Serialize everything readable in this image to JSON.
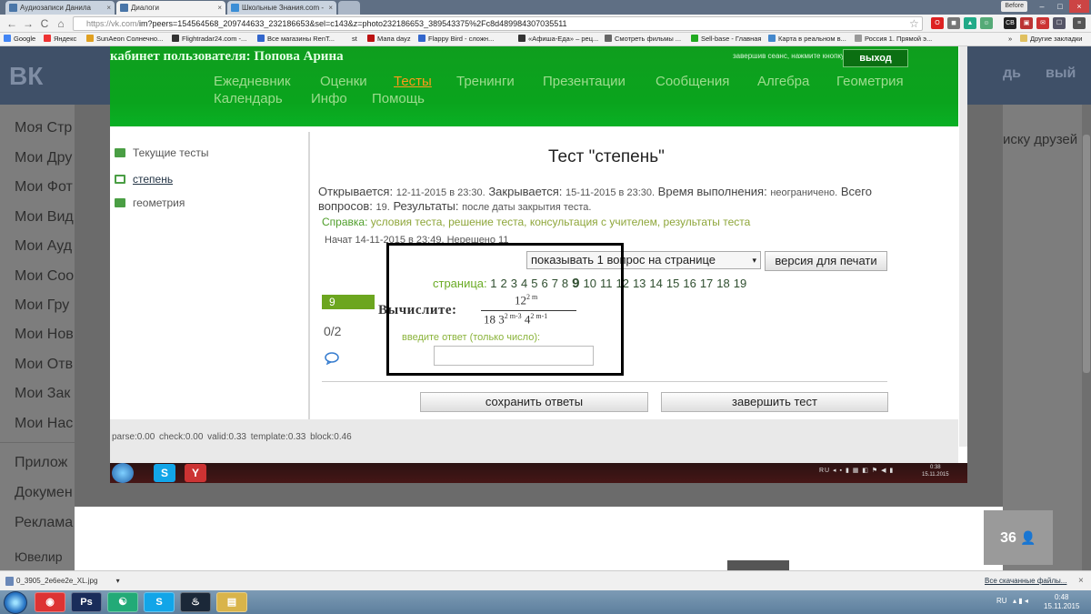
{
  "browser": {
    "tabs": [
      {
        "title": "Аудиозаписи Данила",
        "color": "#4a76a8",
        "close": "×"
      },
      {
        "title": "Диалоги",
        "color": "#4a76a8",
        "close": "×"
      },
      {
        "title": "Школьные Знания.com -",
        "color": "#3b8ed6",
        "close": "×"
      }
    ],
    "user_button": "Before",
    "window_controls": [
      "–",
      "□",
      "×"
    ],
    "nav": {
      "back": "←",
      "forward": "→",
      "reload": "C",
      "home": "⌂"
    },
    "url_host": "https://vk.com/",
    "url_path": "im?peers=154564568_209744633_232186653&sel=c143&z=photo232186653_389543375%2Fc8d489984307035511",
    "star": "☆",
    "extensions": [
      {
        "label": "O",
        "color": "#d22"
      },
      {
        "label": "◼",
        "color": "#777"
      },
      {
        "label": "▲",
        "color": "#2a8"
      },
      {
        "label": "☺",
        "color": "#5a7"
      },
      {
        "label": "CB",
        "color": "#222"
      },
      {
        "label": "▣",
        "color": "#b33"
      },
      {
        "label": "✉",
        "color": "#c33"
      },
      {
        "label": "☐",
        "color": "#556"
      },
      {
        "label": "≡",
        "color": "#555"
      }
    ],
    "bookmarks": [
      {
        "label": "Google",
        "color": "#4285f4"
      },
      {
        "label": "Яндекс",
        "color": "#e33"
      },
      {
        "label": "SunAeon Солнечно...",
        "color": "#e0a020"
      },
      {
        "label": "Flightradar24.com -...",
        "color": "#333"
      },
      {
        "label": "Все магазины RenT...",
        "color": "#36c"
      },
      {
        "label": "st",
        "color": "#888"
      },
      {
        "label": "Мапа dayz",
        "color": "#b11"
      },
      {
        "label": "Flappy Bird - сложн...",
        "color": "#36c"
      },
      {
        "label": "«Афиша-Еда» – рец...",
        "color": "#333"
      },
      {
        "label": "Смотреть фильмы ...",
        "color": "#666"
      },
      {
        "label": "Sell-base - Главная",
        "color": "#2a2"
      },
      {
        "label": "Карта в реальном в...",
        "color": "#48c"
      },
      {
        "label": "Россия 1. Прямой э...",
        "color": "#999"
      }
    ],
    "bookmarks_more": "»",
    "other_bookmarks": "Другие закладки"
  },
  "vk": {
    "logo": "ВК",
    "header_right": [
      "дь",
      "вый"
    ],
    "left_menu": [
      "Моя Стр",
      "Мои Дру",
      "Мои Фот",
      "Мои Вид",
      "Мои Ауд",
      "Мои Соо",
      "Мои Гру",
      "Мои Нов",
      "Мои Отв",
      "Мои Зак",
      "Мои Нас",
      "Прилож",
      "Докумен",
      "Реклама",
      "Ювелир"
    ],
    "right_text": "иску друзей",
    "views_count": "36",
    "views_icon": "👤"
  },
  "photo": {
    "cabinet_title": "кабинет пользователя: Попова Арина",
    "logout_hint": "завершив сеанс, нажмите кнопку",
    "logout_label": "выход",
    "menu_row1": [
      "Ежедневник",
      "Оценки",
      "Тесты",
      "Тренинги",
      "Презентации",
      "Сообщения",
      "Алгебра",
      "Геометрия"
    ],
    "menu_row2": [
      "Календарь",
      "Инфо",
      "Помощь"
    ],
    "active_menu": "Тесты",
    "sidebar": {
      "current_tests": "Текущие тесты",
      "item1": "степень",
      "item2": "геометрия"
    },
    "test_title": "Тест \"степень\"",
    "info": {
      "opens_label": "Открывается:",
      "opens_value": "12-11-2015 в 23:30.",
      "closes_label": "Закрывается:",
      "closes_value": "15-11-2015 в 23:30.",
      "time_label": "Время выполнения:",
      "time_value": "неограничено.",
      "total_label": "Всего",
      "questions_label": "вопросов:",
      "questions_value": "19.",
      "results_label": "Результаты:",
      "results_value": "после даты закрытия теста."
    },
    "reference": {
      "label": "Справка:",
      "links": "условия теста, решение теста, консультация с учителем, результаты теста"
    },
    "started": "Начат 14-11-2015 в 23:49. Нерешено 11",
    "per_page": "показывать 1 вопрос на странице",
    "per_page_arrow": "▾",
    "print_label": "версия для печати",
    "pager_label": "страница:",
    "pages": [
      "1",
      "2",
      "3",
      "4",
      "5",
      "6",
      "7",
      "8",
      "9",
      "10",
      "11",
      "12",
      "13",
      "14",
      "15",
      "16",
      "17",
      "18",
      "19"
    ],
    "current_page": "9",
    "question_number": "9",
    "score": "0/2",
    "calc_label": "Вычислите:",
    "numerator_base": "12",
    "numerator_exp": "2 m",
    "denominator_coef": "18",
    "den_base1": "3",
    "den_exp1": "2 m-3",
    "den_base2": "4",
    "den_exp2": "2 m-1",
    "answer_hint": "введите ответ (только число):",
    "save_label": "сохранить ответы",
    "finish_label": "завершить тест",
    "parse_stats": "parse:0.00 check:0.00 valid:0.33 template:0.33 block:0.46",
    "inner_taskbar": {
      "tray": "RU ◂ ▪ ▮ ▦ ◧ ⚑ ◀ ▮",
      "time": "0:38",
      "date": "15.11.2015"
    }
  },
  "downloads": {
    "file": "0_3905_2e6ee2e_XL.jpg",
    "file_arrow": "▾",
    "show_all": "Все скачанные файлы...",
    "close": "×"
  },
  "taskbar": {
    "apps": [
      {
        "label": "◉",
        "color": "#d33"
      },
      {
        "label": "Ps",
        "color": "#1a2d5a"
      },
      {
        "label": "☯",
        "color": "#2a7"
      },
      {
        "label": "S",
        "color": "#12a5e8"
      },
      {
        "label": "♨",
        "color": "#1b2838"
      },
      {
        "label": "▤",
        "color": "#d9b44a"
      }
    ],
    "lang": "RU",
    "tray_icons": "▴ ▮ ◂",
    "time": "0:48",
    "date": "15.11.2015"
  }
}
